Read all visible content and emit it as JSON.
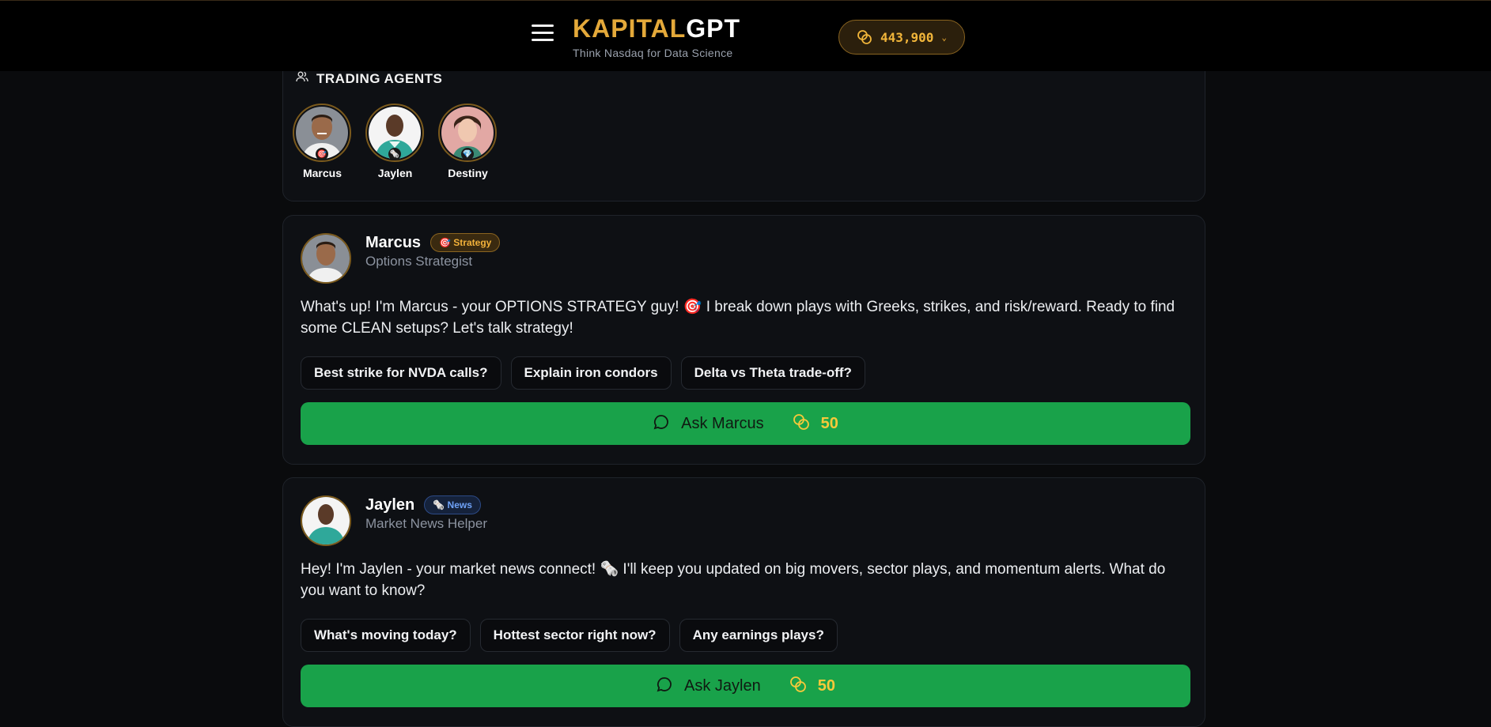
{
  "header": {
    "menu_icon": "hamburger-menu-icon",
    "brand_part1": "KAPITAL",
    "brand_part2": "GPT",
    "tagline": "Think Nasdaq for Data Science",
    "coin_balance": "443,900",
    "coin_icon": "coins-icon",
    "accent_color": "#e4a93a"
  },
  "agents_panel": {
    "title": "TRADING AGENTS",
    "icon": "users-icon",
    "agents": [
      {
        "name": "Marcus",
        "badge_icon": "target-emoji"
      },
      {
        "name": "Jaylen",
        "badge_icon": "newspaper-emoji"
      },
      {
        "name": "Destiny",
        "badge_icon": "gem-emoji"
      }
    ]
  },
  "agent_cards": [
    {
      "name": "Marcus",
      "tag": "🎯 Strategy",
      "role": "Options Strategist",
      "message": "What's up! I'm Marcus - your OPTIONS STRATEGY guy! 🎯 I break down plays with Greeks, strikes, and risk/reward. Ready to find some CLEAN setups? Let's talk strategy!",
      "chips": [
        "Best strike for NVDA calls?",
        "Explain iron condors",
        "Delta vs Theta trade-off?"
      ],
      "ask_label": "Ask Marcus",
      "ask_cost": "50"
    },
    {
      "name": "Jaylen",
      "tag": "🗞️ News",
      "role": "Market News Helper",
      "message": "Hey! I'm Jaylen - your market news connect! 🗞️ I'll keep you updated on big movers, sector plays, and momentum alerts. What do you want to know?",
      "chips": [
        "What's moving today?",
        "Hottest sector right now?",
        "Any earnings plays?"
      ],
      "ask_label": "Ask Jaylen",
      "ask_cost": "50"
    }
  ],
  "colors": {
    "background": "#0a0b0d",
    "ask_button": "#19a24a",
    "cost_text": "#f6c93a"
  }
}
